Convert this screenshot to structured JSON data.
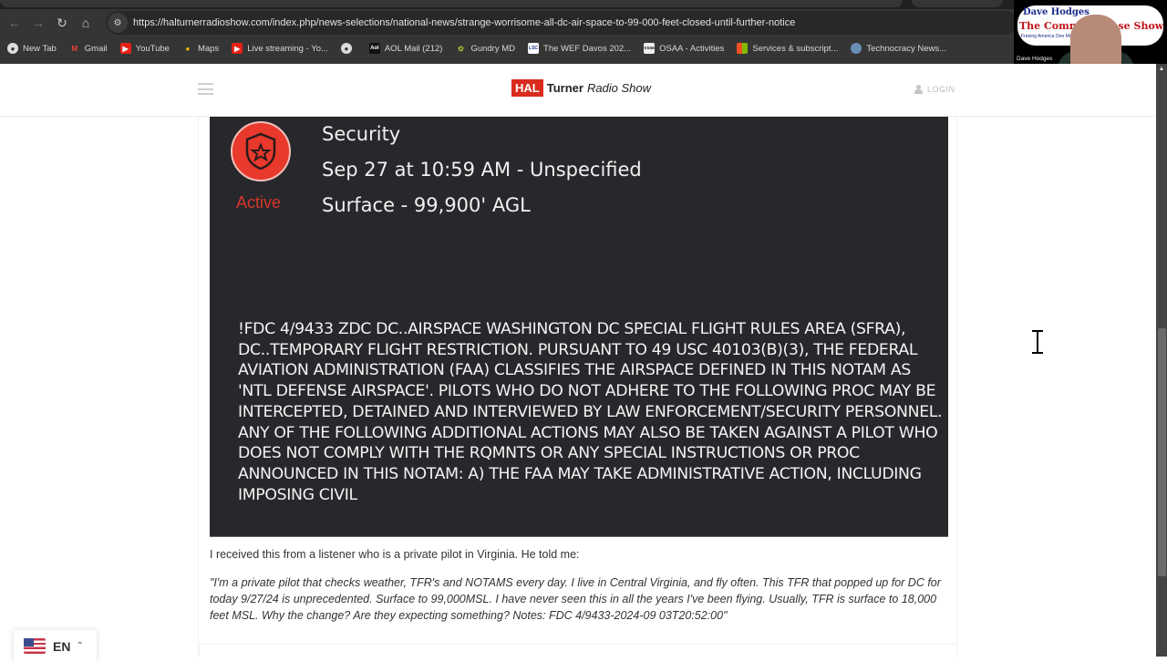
{
  "browser": {
    "url": "https://halturnerradioshow.com/index.php/news-selections/national-news/strange-worrisome-all-dc-air-space-to-99-000-feet-closed-until-further-notice",
    "bookmarks": [
      {
        "label": "New Tab",
        "icon": "globe-icon"
      },
      {
        "label": "Gmail",
        "icon": "gmail-icon"
      },
      {
        "label": "YouTube",
        "icon": "youtube-icon"
      },
      {
        "label": "Maps",
        "icon": "maps-icon"
      },
      {
        "label": "Live streaming - Yo...",
        "icon": "youtube-icon"
      },
      {
        "label": "",
        "icon": "globe-icon"
      },
      {
        "label": "AOL Mail (212)",
        "icon": "aol-icon"
      },
      {
        "label": "Gundry MD",
        "icon": "gundry-icon"
      },
      {
        "label": "The WEF Davos 202...",
        "icon": "lsc-icon"
      },
      {
        "label": "OSAA - Activities",
        "icon": "osaa-icon"
      },
      {
        "label": "Services & subscript...",
        "icon": "microsoft-icon"
      },
      {
        "label": "Technocracy News...",
        "icon": "technocracy-icon"
      }
    ]
  },
  "webcam": {
    "banner_line1": "Dave Hodges",
    "banner_line2": "The Common Sense Show",
    "banner_line3": "Freeing America One Mind at a Time",
    "name": "Dave Hodges"
  },
  "site": {
    "logo_hal": "HAL",
    "logo_turner": "Turner",
    "logo_radio": "Radio Show",
    "login": "LOGIN"
  },
  "notam": {
    "title": "Security",
    "time": "Sep 27 at 10:59 AM - Unspecified",
    "altitude": "Surface - 99,900' AGL",
    "status": "Active",
    "body": "!FDC 4/9433 ZDC DC..AIRSPACE WASHINGTON DC SPECIAL FLIGHT RULES AREA (SFRA), DC..TEMPORARY FLIGHT RESTRICTION. PURSUANT TO 49 USC 40103(B)(3), THE FEDERAL AVIATION ADMINISTRATION (FAA) CLASSIFIES THE AIRSPACE DEFINED IN THIS NOTAM AS 'NTL DEFENSE AIRSPACE'. PILOTS WHO DO NOT ADHERE TO THE FOLLOWING PROC MAY BE INTERCEPTED, DETAINED AND INTERVIEWED BY LAW ENFORCEMENT/SECURITY PERSONNEL. ANY OF THE FOLLOWING ADDITIONAL ACTIONS MAY ALSO BE TAKEN AGAINST A PILOT WHO DOES NOT COMPLY WITH THE RQMNTS OR ANY SPECIAL INSTRUCTIONS OR PROC ANNOUNCED IN THIS NOTAM: A) THE FAA MAY TAKE ADMINISTRATIVE ACTION, INCLUDING IMPOSING CIVIL",
    "status_color": "#d6372b",
    "badge_color": "#e8392c"
  },
  "article": {
    "intro": "I received this from a listener who is a private pilot in Virginia.  He told me:",
    "quote": "\"I'm a private pilot that checks weather, TFR's and NOTAMS every day.  I live in Central Virginia, and fly often. This TFR that popped up for DC for today 9/27/24 is unprecedented.  Surface to 99,000MSL.  I have never seen this in all the years I've been flying. Usually, TFR is surface to 18,000 feet MSL.  Why the change? Are they expecting something?  Notes: FDC 4/9433-2024-09 03T20:52:00\""
  },
  "language": {
    "code": "EN"
  }
}
